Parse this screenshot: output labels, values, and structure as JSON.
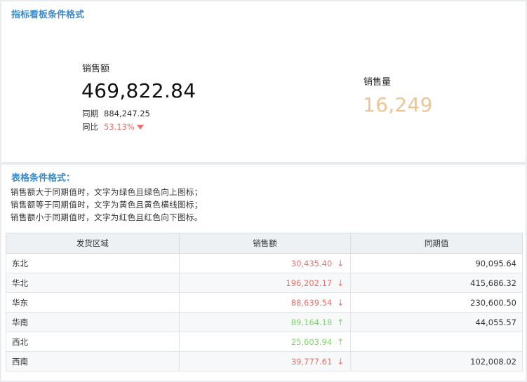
{
  "kpi_panel": {
    "title": "指标看板条件格式",
    "sales_amount": {
      "label": "销售额",
      "value": "469,822.84",
      "prior_label": "同期",
      "prior_value": "884,247.25",
      "yoy_label": "同比",
      "yoy_value": "53.13%",
      "yoy_icon": "triangle-down-icon"
    },
    "sales_volume": {
      "label": "销售量",
      "value": "16,249",
      "color": "#f0c493"
    }
  },
  "table_panel": {
    "title": "表格条件格式：",
    "rules": [
      "销售额大于同期值时，文字为绿色且绿色向上图标；",
      "销售额等于同期值时，文字为黄色且黄色横线图标；",
      "销售额小于同期值时，文字为红色且红色向下图标。"
    ],
    "headers": [
      "发货区域",
      "销售额",
      "同期值"
    ],
    "rows": [
      {
        "region": "东北",
        "sales": "30,435.40",
        "prior": "90,095.64",
        "trend": "down"
      },
      {
        "region": "华北",
        "sales": "196,202.17",
        "prior": "415,686.32",
        "trend": "down"
      },
      {
        "region": "华东",
        "sales": "88,639.54",
        "prior": "230,600.50",
        "trend": "down"
      },
      {
        "region": "华南",
        "sales": "89,164.18",
        "prior": "44,055.57",
        "trend": "up"
      },
      {
        "region": "西北",
        "sales": "25,603.94",
        "prior": "",
        "trend": "up"
      },
      {
        "region": "西南",
        "sales": "39,777.61",
        "prior": "102,008.02",
        "trend": "down"
      }
    ]
  },
  "colors": {
    "title_blue": "#3d8ac9",
    "negative_red": "#ef6f6c",
    "positive_green": "#7fd46a",
    "volume_orange": "#f0c493"
  }
}
